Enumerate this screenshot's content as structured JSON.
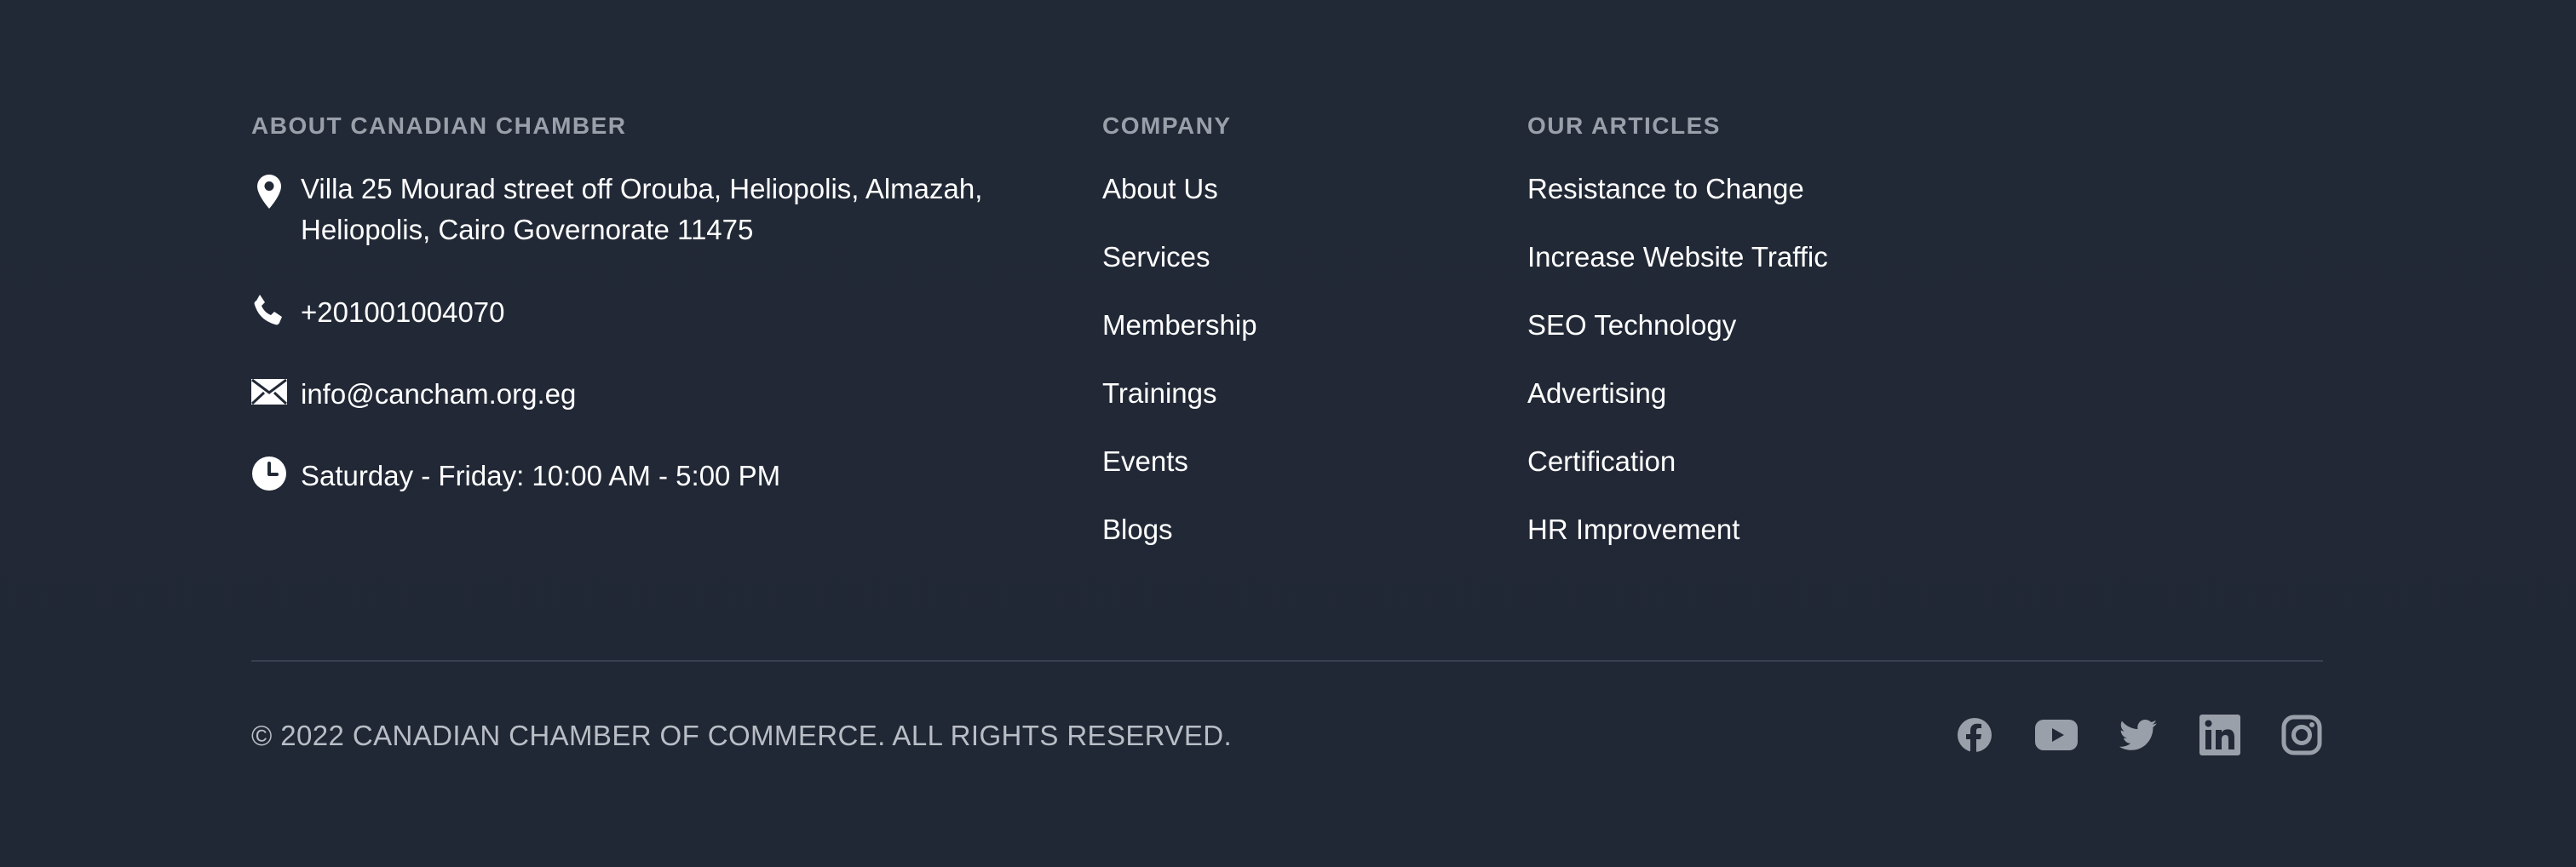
{
  "about": {
    "heading": "ABOUT CANADIAN CHAMBER",
    "address_line1": "Villa 25 Mourad street off Orouba, Heliopolis, Almazah,",
    "address_line2": "Heliopolis, Cairo Governorate 11475",
    "phone": "+201001004070",
    "email": "info@cancham.org.eg",
    "hours": "Saturday - Friday: 10:00 AM - 5:00 PM",
    "icons": [
      "location-pin-icon",
      "phone-icon",
      "envelope-icon",
      "clock-icon"
    ]
  },
  "company": {
    "heading": "COMPANY",
    "links": [
      "About Us",
      "Services",
      "Membership",
      "Trainings",
      "Events",
      "Blogs"
    ]
  },
  "articles": {
    "heading": "OUR ARTICLES",
    "links": [
      "Resistance to Change",
      "Increase Website Traffic",
      "SEO Technology",
      "Advertising",
      "Certification",
      "HR Improvement"
    ]
  },
  "bottom": {
    "copyright": "© 2022 CANADIAN CHAMBER OF COMMERCE. ALL RIGHTS RESERVED.",
    "social_icons": [
      "facebook-icon",
      "youtube-icon",
      "twitter-icon",
      "linkedin-icon",
      "instagram-icon"
    ]
  },
  "colors": {
    "background": "#222936",
    "heading": "#9aa0aa",
    "text": "#ffffff",
    "muted": "#b9bec6",
    "social": "#9aa0aa",
    "divider": "#394150"
  }
}
